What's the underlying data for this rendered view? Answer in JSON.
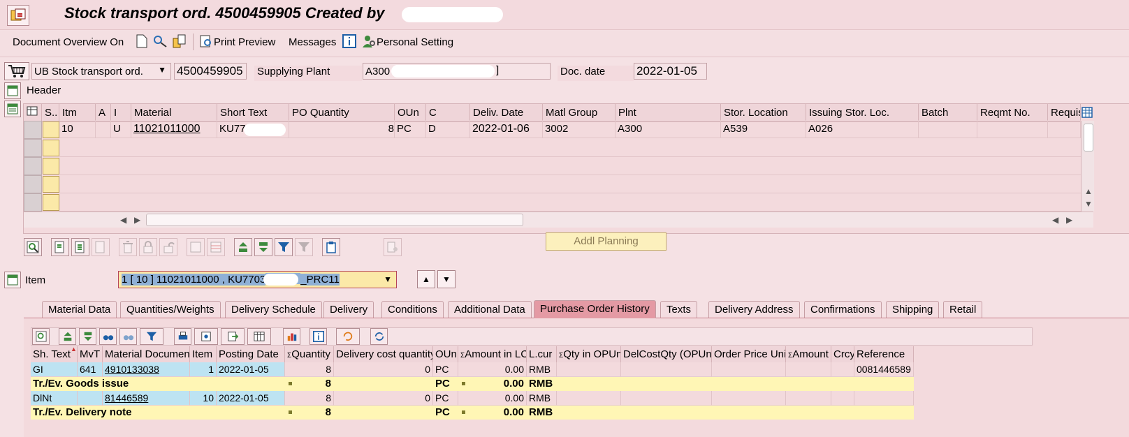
{
  "window": {
    "title_prefix": "Stock transport ord. 4500459905 Created by"
  },
  "toolbar": {
    "document_overview": "Document Overview On",
    "print_preview": "Print Preview",
    "messages": "Messages",
    "personal_setting": "Personal Setting"
  },
  "header_fields": {
    "doc_type": "UB Stock transport ord.",
    "po_number": "4500459905",
    "supplying_plant_label": "Supplying Plant",
    "supplying_plant_value": "A300",
    "doc_date_label": "Doc. date",
    "doc_date_value": "2022-01-05",
    "header_label": "Header"
  },
  "items_table": {
    "columns": [
      "S..",
      "Itm",
      "A",
      "I",
      "Material",
      "Short Text",
      "PO Quantity",
      "OUn",
      "C",
      "Deliv. Date",
      "Matl Group",
      "Plnt",
      "Stor. Location",
      "Issuing Stor. Loc.",
      "Batch",
      "Reqmt No.",
      "Requis"
    ],
    "row": {
      "itm": "10",
      "i": "U",
      "material": "11021011000",
      "short_text": "KU770",
      "po_quantity": "8",
      "oun": "PC",
      "c": "D",
      "deliv_date": "2022-01-06",
      "matl_group": "3002",
      "plnt": "A300",
      "stor_location": "A539",
      "issuing_stor_loc": "A026"
    }
  },
  "addl_planning": "Addl Planning",
  "item_selector": {
    "label": "Item",
    "value_prefix": "1 [ 10 ] 11021011000 , KU7703",
    "value_suffix": "_PRC11"
  },
  "tabs": [
    "Material Data",
    "Quantities/Weights",
    "Delivery Schedule",
    "Delivery",
    "Conditions",
    "Additional Data",
    "Purchase Order History",
    "Texts",
    "Delivery Address",
    "Confirmations",
    "Shipping",
    "Retail"
  ],
  "active_tab": "Purchase Order History",
  "history": {
    "columns": [
      "Sh. Text",
      "MvT",
      "Material Document",
      "Item",
      "Posting Date",
      "Quantity",
      "Delivery cost quantity",
      "OUn",
      "Amount in LC",
      "L.cur",
      "Qty in OPUn",
      "DelCostQty (OPUn)",
      "Order Price Unit",
      "Amount",
      "Crcy",
      "Reference"
    ],
    "sigma": "Σ",
    "rows": [
      {
        "sh_text": "GI",
        "mvt": "641",
        "mat_doc": "4910133038",
        "item": "1",
        "posting_date": "2022-01-05",
        "quantity": "8",
        "del_cost_qty": "0",
        "oun": "PC",
        "amount_lc": "0.00",
        "lcur": "RMB",
        "reference": "0081446589"
      },
      {
        "sh_text": "Tr./Ev. Goods issue",
        "quantity": "8",
        "oun": "PC",
        "amount_lc": "0.00",
        "lcur": "RMB"
      },
      {
        "sh_text": "DlNt",
        "mvt": "",
        "mat_doc": "81446589",
        "item": "10",
        "posting_date": "2022-01-05",
        "quantity": "8",
        "del_cost_qty": "0",
        "oun": "PC",
        "amount_lc": "0.00",
        "lcur": "RMB",
        "reference": ""
      },
      {
        "sh_text": "Tr./Ev. Delivery note",
        "quantity": "8",
        "oun": "PC",
        "amount_lc": "0.00",
        "lcur": "RMB"
      }
    ]
  },
  "colors": {
    "background": "#f5e1e4",
    "active_tab": "#e49aa4",
    "doc_row": "#bde3f2",
    "total_row": "#fff6b5"
  }
}
